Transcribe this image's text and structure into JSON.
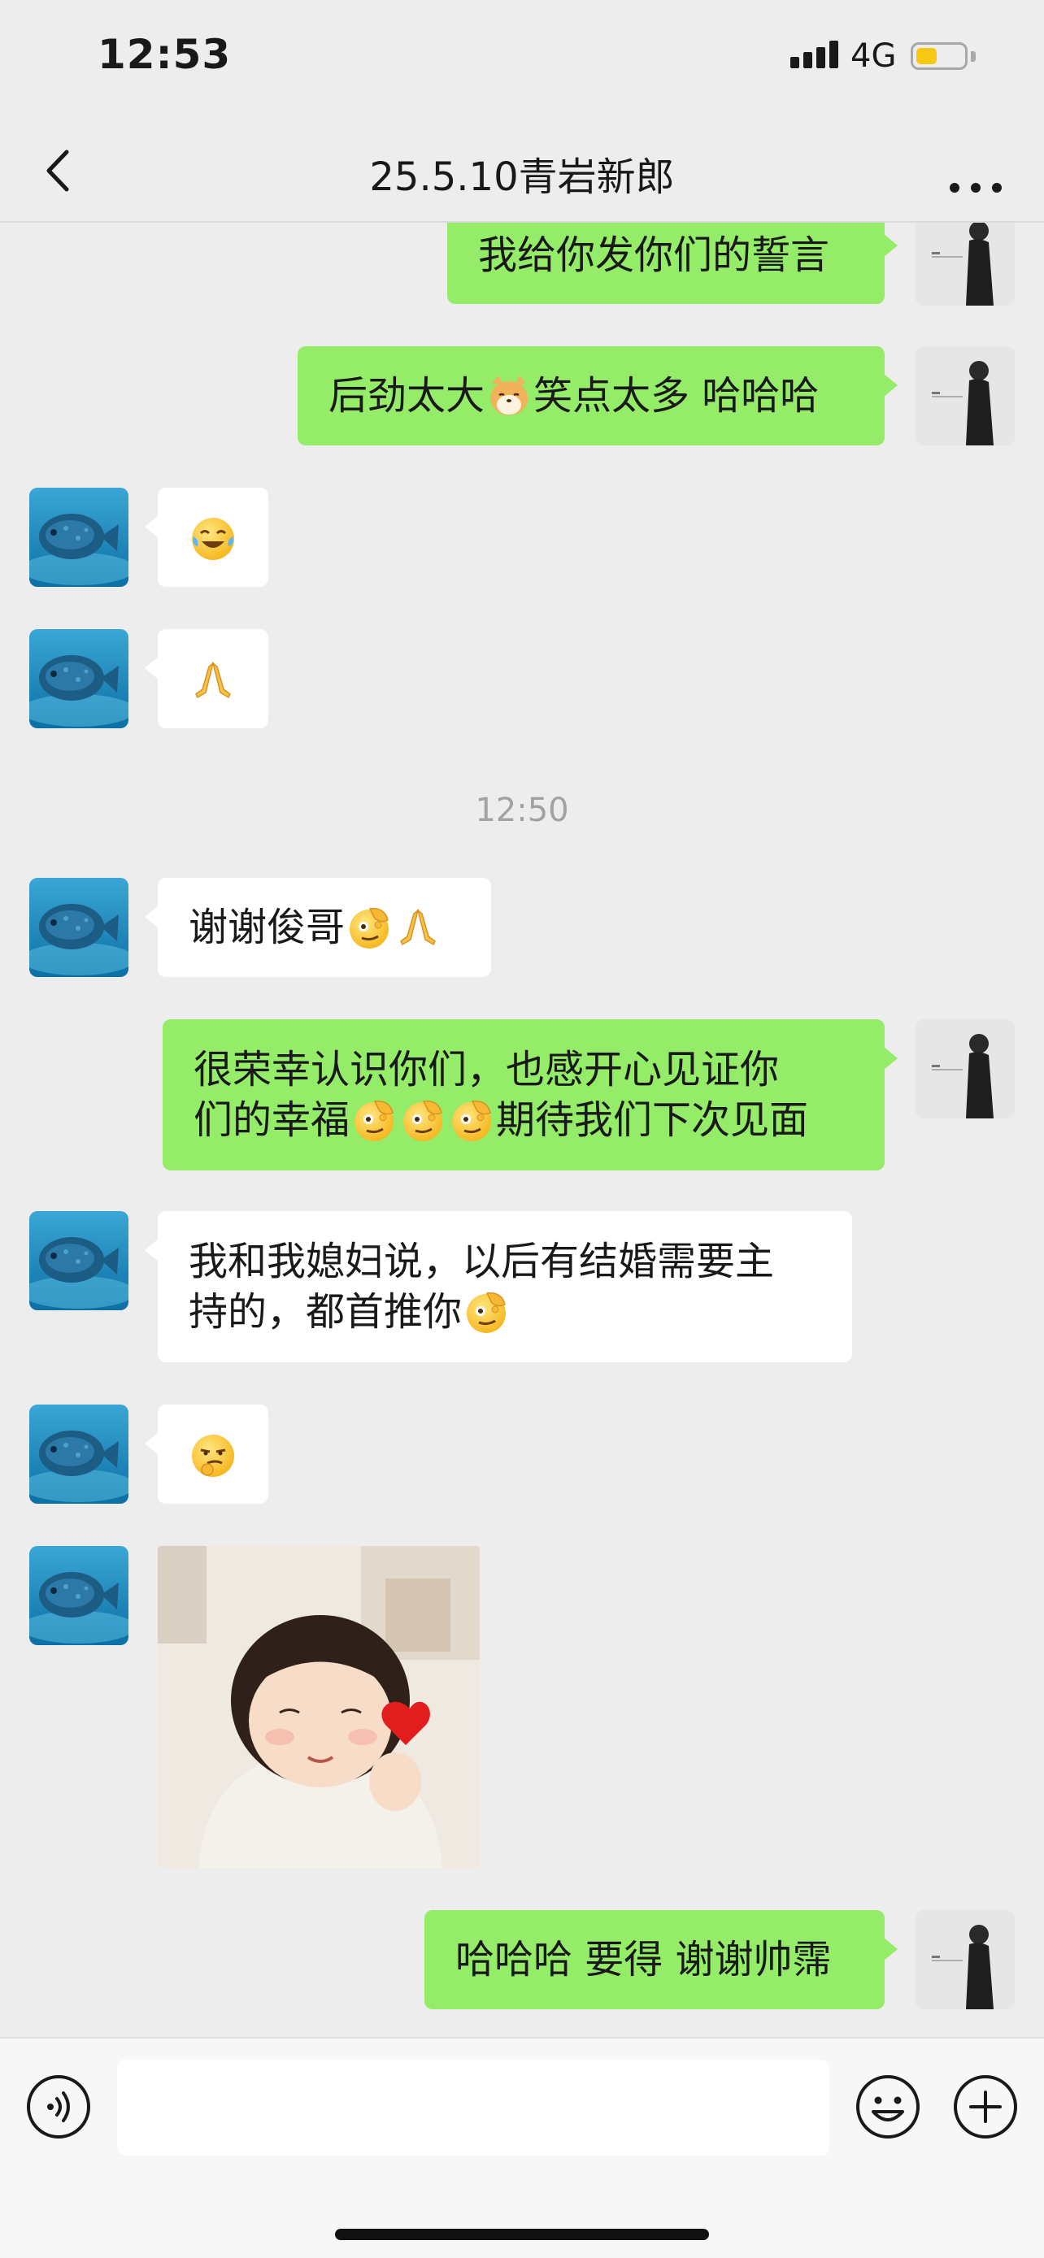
{
  "status_bar": {
    "time": "12:53",
    "network": "4G",
    "battery_level": 0.45
  },
  "header": {
    "title": "25.5.10青岩新郎",
    "back_icon": "chevron-left-icon",
    "more_icon": "more-dots-icon"
  },
  "messages": {
    "m1": {
      "sender": "self",
      "text": "我给你发你们的誓言"
    },
    "m2": {
      "sender": "self",
      "part1": "后劲太大",
      "emoji": "dog-face-emoji",
      "part2": "笑点太多 哈哈哈"
    },
    "m3": {
      "sender": "other",
      "emoji": "laughing-crying-emoji"
    },
    "m4": {
      "sender": "other",
      "emoji": "folded-hands-emoji"
    },
    "time_divider": "12:50",
    "m5": {
      "sender": "other",
      "text": "谢谢俊哥",
      "emojis": [
        "salute-emoji",
        "folded-hands-emoji"
      ]
    },
    "m6": {
      "sender": "self",
      "line1": "很荣幸认识你们，也感开心见证你",
      "line2_part1": "们的幸福",
      "emojis": [
        "salute-emoji",
        "salute-emoji",
        "salute-emoji"
      ],
      "line2_part2": "期待我们下次见面"
    },
    "m7": {
      "sender": "other",
      "line1": "我和我媳妇说，以后有结婚需要主",
      "line2": "持的，都首推你",
      "emoji": "salute-emoji"
    },
    "m8": {
      "sender": "other",
      "emoji": "thinking-smirk-emoji"
    },
    "m9": {
      "sender": "other",
      "image": "girl-with-heart-sticker"
    },
    "m10": {
      "sender": "self",
      "text": "哈哈哈 要得 谢谢帅霈"
    }
  },
  "input_bar": {
    "placeholder": "",
    "voice_icon": "voice-icon",
    "emoji_icon": "smiley-icon",
    "plus_icon": "plus-circle-icon"
  },
  "colors": {
    "outgoing_bubble": "#95ec69",
    "incoming_bubble": "#ffffff",
    "background": "#ededed"
  }
}
